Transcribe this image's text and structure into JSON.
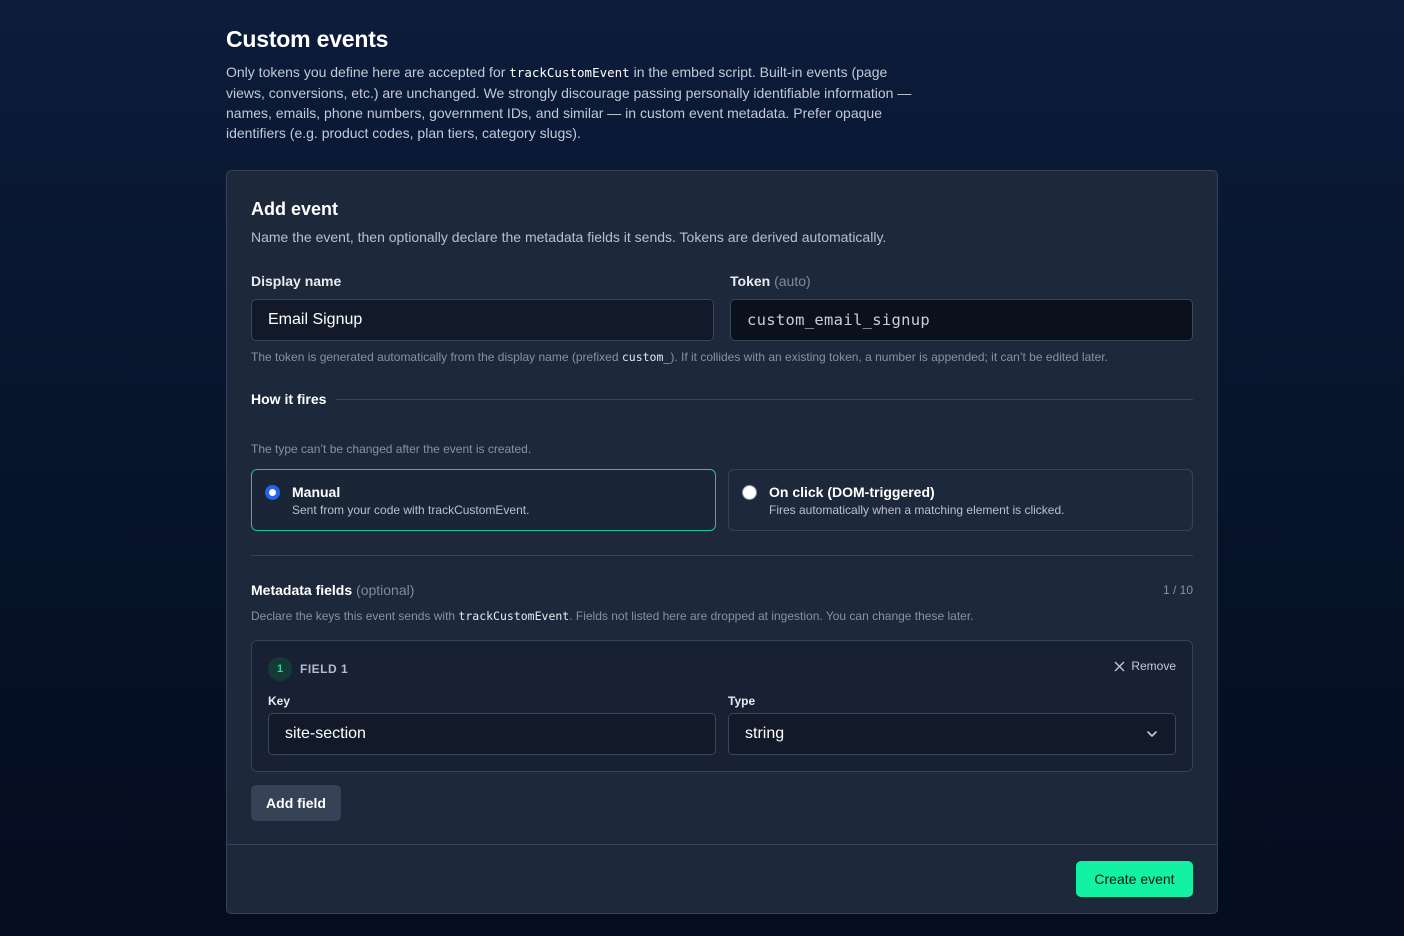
{
  "header": {
    "title": "Custom events",
    "desc_part1": "Only tokens you define here are accepted for ",
    "desc_code": "trackCustomEvent",
    "desc_part2": " in the embed script. Built-in events (page views, conversions, etc.) are unchanged. We strongly discourage passing personally identifiable information — names, emails, phone numbers, government IDs, and similar — in custom event metadata. Prefer opaque identifiers (e.g. product codes, plan tiers, category slugs)."
  },
  "add_event": {
    "title": "Add event",
    "description": "Name the event, then optionally declare the metadata fields it sends. Tokens are derived automatically.",
    "display_name_label": "Display name",
    "display_name_value": "Email Signup",
    "token_label": "Token",
    "token_hint": "(auto)",
    "token_value": "custom_email_signup",
    "token_help_part1": "The token is generated automatically from the display name (prefixed ",
    "token_help_code": "custom_",
    "token_help_part2": "). If it collides with an existing token, a number is appended; it can’t be edited later."
  },
  "how_it_fires": {
    "title": "How it fires",
    "help": "The type can’t be changed after the event is created.",
    "options": [
      {
        "title": "Manual",
        "subtitle": "Sent from your code with trackCustomEvent.",
        "selected": true
      },
      {
        "title": "On click (DOM-triggered)",
        "subtitle": "Fires automatically when a matching element is clicked.",
        "selected": false
      }
    ]
  },
  "metadata": {
    "label": "Metadata fields",
    "optional": "(optional)",
    "count": "1 / 10",
    "help_part1": "Declare the keys this event sends with ",
    "help_code": "trackCustomEvent",
    "help_part2": ". Fields not listed here are dropped at ingestion. You can change these later.",
    "fields": [
      {
        "number": "1",
        "name": "FIELD 1",
        "remove_label": "Remove",
        "key_label": "Key",
        "key_value": "site-section",
        "type_label": "Type",
        "type_value": "string"
      }
    ],
    "add_field_label": "Add field"
  },
  "footer": {
    "create_label": "Create event"
  },
  "colors": {
    "accent": "#13f2a4",
    "selected_border": "#1fc49a",
    "radio_blue": "#2563eb"
  },
  "icons": {
    "remove": "close-icon",
    "select": "chevron-down-icon"
  }
}
